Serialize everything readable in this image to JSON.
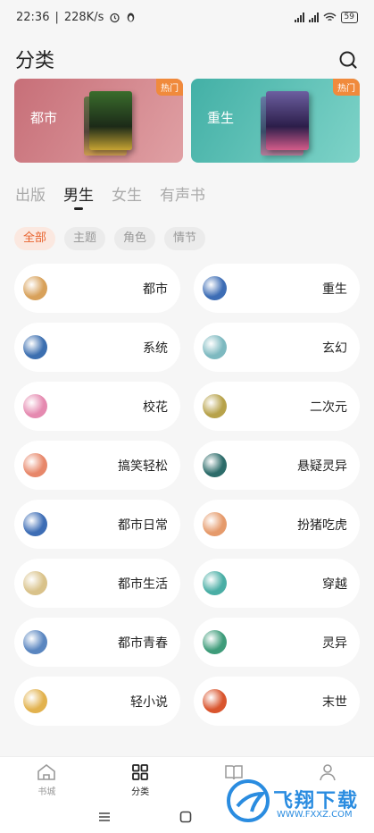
{
  "status": {
    "time": "22:36",
    "speed": "228K/s",
    "battery": "59"
  },
  "header": {
    "title": "分类"
  },
  "banners": [
    {
      "name": "都市",
      "tag": "热门"
    },
    {
      "name": "重生",
      "tag": "热门"
    }
  ],
  "tabs": [
    "出版",
    "男生",
    "女生",
    "有声书"
  ],
  "filters": [
    "全部",
    "主题",
    "角色",
    "情节"
  ],
  "categories": [
    {
      "label": "都市",
      "color": "#d8a15a"
    },
    {
      "label": "重生",
      "color": "#3d6db5"
    },
    {
      "label": "系统",
      "color": "#3c6fb0"
    },
    {
      "label": "玄幻",
      "color": "#7db9c0"
    },
    {
      "label": "校花",
      "color": "#e58ab0"
    },
    {
      "label": "二次元",
      "color": "#b7a24a"
    },
    {
      "label": "搞笑轻松",
      "color": "#e7876a"
    },
    {
      "label": "悬疑灵异",
      "color": "#2d6c6a"
    },
    {
      "label": "都市日常",
      "color": "#3d6db5"
    },
    {
      "label": "扮猪吃虎",
      "color": "#e59a6b"
    },
    {
      "label": "都市生活",
      "color": "#d9c28a"
    },
    {
      "label": "穿越",
      "color": "#4aaea5"
    },
    {
      "label": "都市青春",
      "color": "#5a86c0"
    },
    {
      "label": "灵异",
      "color": "#3e9c7a"
    },
    {
      "label": "轻小说",
      "color": "#e2b24e"
    },
    {
      "label": "末世",
      "color": "#d9552e"
    }
  ],
  "nav": [
    "书城",
    "分类",
    "",
    ""
  ],
  "watermark": {
    "text": "飞翔下载",
    "url": "WWW.FXXZ.COM"
  }
}
